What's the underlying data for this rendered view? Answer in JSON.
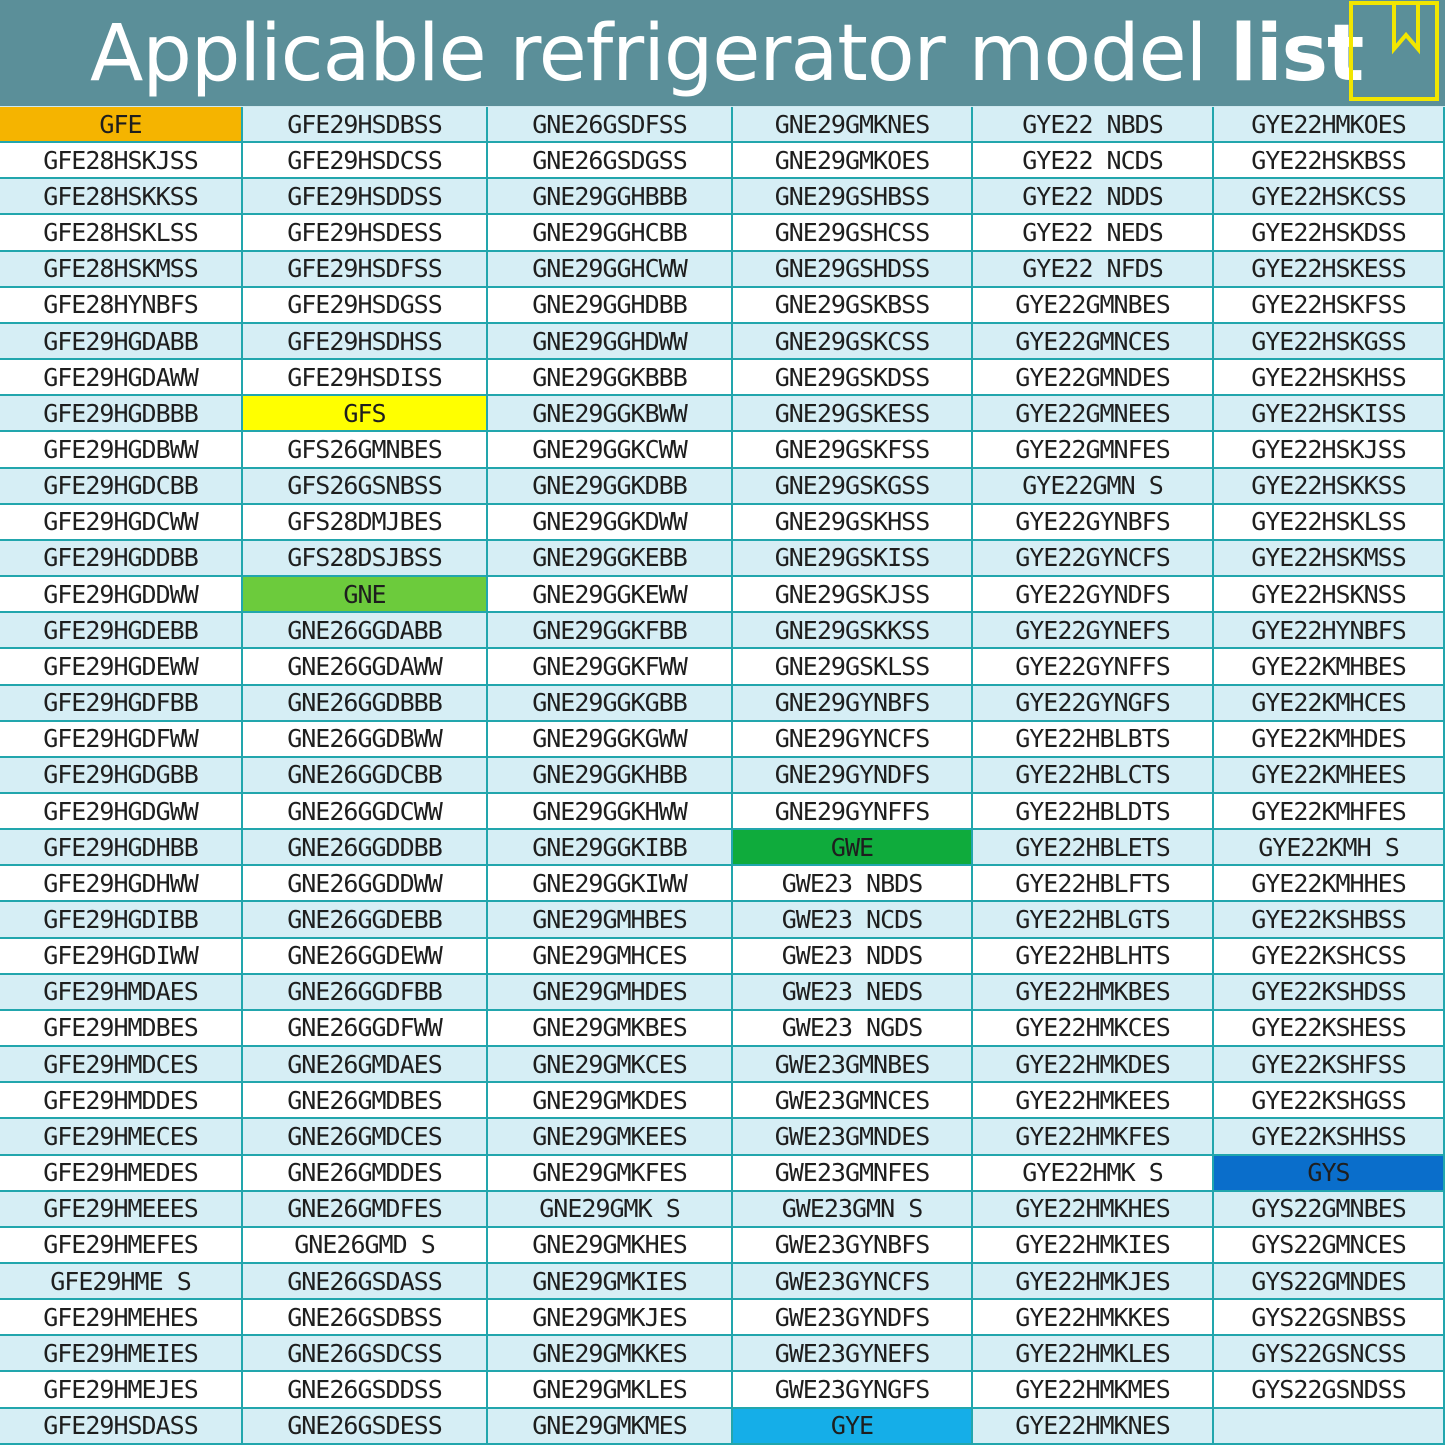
{
  "title": {
    "part1": "Applicable refrigerator model ",
    "part2": "list"
  },
  "headers": {
    "GFE": "#f5b400",
    "GFS": "#ffff00",
    "GNE": "#6ccb3c",
    "GWE": "#0fab3c",
    "GYE": "#15aee8",
    "GYS": "#0a6ecb"
  },
  "columns": [
    [
      "GFE",
      "GFE28HSKJSS",
      "GFE28HSKKSS",
      "GFE28HSKLSS",
      "GFE28HSKMSS",
      "GFE28HYNBFS",
      "GFE29HGDABB",
      "GFE29HGDAWW",
      "GFE29HGDBBB",
      "GFE29HGDBWW",
      "GFE29HGDCBB",
      "GFE29HGDCWW",
      "GFE29HGDDBB",
      "GFE29HGDDWW",
      "GFE29HGDEBB",
      "GFE29HGDEWW",
      "GFE29HGDFBB",
      "GFE29HGDFWW",
      "GFE29HGDGBB",
      "GFE29HGDGWW",
      "GFE29HGDHBB",
      "GFE29HGDHWW",
      "GFE29HGDIBB",
      "GFE29HGDIWW",
      "GFE29HMDAES",
      "GFE29HMDBES",
      "GFE29HMDCES",
      "GFE29HMDDES",
      "GFE29HMECES",
      "GFE29HMEDES",
      "GFE29HMEEES",
      "GFE29HMEFES",
      "GFE29HME S",
      "GFE29HMEHES",
      "GFE29HMEIES",
      "GFE29HMEJES",
      "GFE29HSDASS"
    ],
    [
      "GFE29HSDBSS",
      "GFE29HSDCSS",
      "GFE29HSDDSS",
      "GFE29HSDESS",
      "GFE29HSDFSS",
      "GFE29HSDGSS",
      "GFE29HSDHSS",
      "GFE29HSDISS",
      "GFS",
      "GFS26GMNBES",
      "GFS26GSNBSS",
      "GFS28DMJBES",
      "GFS28DSJBSS",
      "GNE",
      "GNE26GGDABB",
      "GNE26GGDAWW",
      "GNE26GGDBBB",
      "GNE26GGDBWW",
      "GNE26GGDCBB",
      "GNE26GGDCWW",
      "GNE26GGDDBB",
      "GNE26GGDDWW",
      "GNE26GGDEBB",
      "GNE26GGDEWW",
      "GNE26GGDFBB",
      "GNE26GGDFWW",
      "GNE26GMDAES",
      "GNE26GMDBES",
      "GNE26GMDCES",
      "GNE26GMDDES",
      "GNE26GMDFES",
      "GNE26GMD S",
      "GNE26GSDASS",
      "GNE26GSDBSS",
      "GNE26GSDCSS",
      "GNE26GSDDSS",
      "GNE26GSDESS"
    ],
    [
      "GNE26GSDFSS",
      "GNE26GSDGSS",
      "GNE29GGHBBB",
      "GNE29GGHCBB",
      "GNE29GGHCWW",
      "GNE29GGHDBB",
      "GNE29GGHDWW",
      "GNE29GGKBBB",
      "GNE29GGKBWW",
      "GNE29GGKCWW",
      "GNE29GGKDBB",
      "GNE29GGKDWW",
      "GNE29GGKEBB",
      "GNE29GGKEWW",
      "GNE29GGKFBB",
      "GNE29GGKFWW",
      "GNE29GGKGBB",
      "GNE29GGKGWW",
      "GNE29GGKHBB",
      "GNE29GGKHWW",
      "GNE29GGKIBB",
      "GNE29GGKIWW",
      "GNE29GMHBES",
      "GNE29GMHCES",
      "GNE29GMHDES",
      "GNE29GMKBES",
      "GNE29GMKCES",
      "GNE29GMKDES",
      "GNE29GMKEES",
      "GNE29GMKFES",
      "GNE29GMK S",
      "GNE29GMKHES",
      "GNE29GMKIES",
      "GNE29GMKJES",
      "GNE29GMKKES",
      "GNE29GMKLES",
      "GNE29GMKMES"
    ],
    [
      "GNE29GMKNES",
      "GNE29GMKOES",
      "GNE29GSHBSS",
      "GNE29GSHCSS",
      "GNE29GSHDSS",
      "GNE29GSKBSS",
      "GNE29GSKCSS",
      "GNE29GSKDSS",
      "GNE29GSKESS",
      "GNE29GSKFSS",
      "GNE29GSKGSS",
      "GNE29GSKHSS",
      "GNE29GSKISS",
      "GNE29GSKJSS",
      "GNE29GSKKSS",
      "GNE29GSKLSS",
      "GNE29GYNBFS",
      "GNE29GYNCFS",
      "GNE29GYNDFS",
      "GNE29GYNFFS",
      "GWE",
      "GWE23 NBDS",
      "GWE23 NCDS",
      "GWE23 NDDS",
      "GWE23 NEDS",
      "GWE23 NGDS",
      "GWE23GMNBES",
      "GWE23GMNCES",
      "GWE23GMNDES",
      "GWE23GMNFES",
      "GWE23GMN S",
      "GWE23GYNBFS",
      "GWE23GYNCFS",
      "GWE23GYNDFS",
      "GWE23GYNEFS",
      "GWE23GYNGFS",
      "GYE"
    ],
    [
      "GYE22 NBDS",
      "GYE22 NCDS",
      "GYE22 NDDS",
      "GYE22 NEDS",
      "GYE22 NFDS",
      "GYE22GMNBES",
      "GYE22GMNCES",
      "GYE22GMNDES",
      "GYE22GMNEES",
      "GYE22GMNFES",
      "GYE22GMN S",
      "GYE22GYNBFS",
      "GYE22GYNCFS",
      "GYE22GYNDFS",
      "GYE22GYNEFS",
      "GYE22GYNFFS",
      "GYE22GYNGFS",
      "GYE22HBLBTS",
      "GYE22HBLCTS",
      "GYE22HBLDTS",
      "GYE22HBLETS",
      "GYE22HBLFTS",
      "GYE22HBLGTS",
      "GYE22HBLHTS",
      "GYE22HMKBES",
      "GYE22HMKCES",
      "GYE22HMKDES",
      "GYE22HMKEES",
      "GYE22HMKFES",
      "GYE22HMK S",
      "GYE22HMKHES",
      "GYE22HMKIES",
      "GYE22HMKJES",
      "GYE22HMKKES",
      "GYE22HMKLES",
      "GYE22HMKMES",
      "GYE22HMKNES"
    ],
    [
      "GYE22HMKOES",
      "GYE22HSKBSS",
      "GYE22HSKCSS",
      "GYE22HSKDSS",
      "GYE22HSKESS",
      "GYE22HSKFSS",
      "GYE22HSKGSS",
      "GYE22HSKHSS",
      "GYE22HSKISS",
      "GYE22HSKJSS",
      "GYE22HSKKSS",
      "GYE22HSKLSS",
      "GYE22HSKMSS",
      "GYE22HSKNSS",
      "GYE22HYNBFS",
      "GYE22KMHBES",
      "GYE22KMHCES",
      "GYE22KMHDES",
      "GYE22KMHEES",
      "GYE22KMHFES",
      "GYE22KMH S",
      "GYE22KMHHES",
      "GYE22KSHBSS",
      "GYE22KSHCSS",
      "GYE22KSHDSS",
      "GYE22KSHESS",
      "GYE22KSHFSS",
      "GYE22KSHGSS",
      "GYE22KSHHSS",
      "GYS",
      "GYS22GMNBES",
      "GYS22GMNCES",
      "GYS22GMNDES",
      "GYS22GSNBSS",
      "GYS22GSNCSS",
      "GYS22GSNDSS",
      ""
    ]
  ]
}
